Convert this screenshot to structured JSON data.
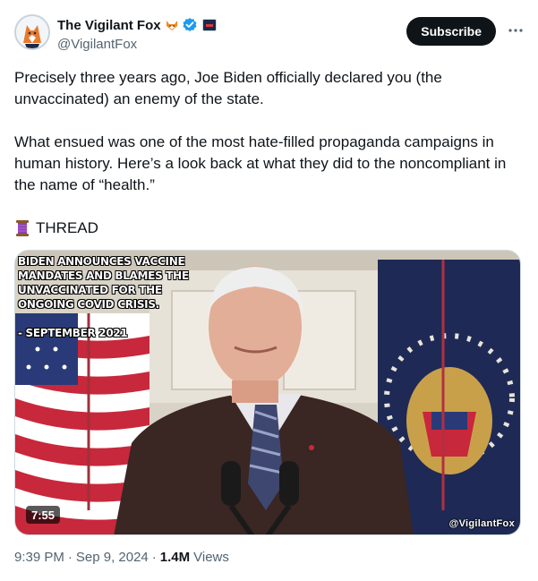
{
  "author": {
    "display_name": "The Vigilant Fox",
    "handle": "@VigilantFox",
    "fox_emoji": "fox-emoji-icon",
    "verified_color": "#1d9bf0"
  },
  "actions": {
    "subscribe_label": "Subscribe",
    "more_label": "More options"
  },
  "tweet": {
    "paragraph_1": "Precisely three years ago, Joe Biden officially declared you (the unvaccinated) an enemy of the state.",
    "paragraph_2": "What ensued was one of the most hate-filled propaganda campaigns in human history. Here’s a look back at what they did to the noncompliant in the name of “health.”",
    "thread_label": "THREAD",
    "thread_icon": "spool-of-thread-icon"
  },
  "media": {
    "caption": "Biden announces vaccine\nmandates and blames the\nunvaccinated for the\nongoing COVID crisis.\n\n- September 2021",
    "duration": "7:55",
    "watermark": "@VigilantFox"
  },
  "meta": {
    "time": "9:39 PM",
    "date": "Sep 9, 2024",
    "views_count": "1.4M",
    "views_label": "Views"
  },
  "colors": {
    "subscribe_bg": "#0f1419",
    "secondary_text": "#536471",
    "primary_text": "#0f1419"
  }
}
